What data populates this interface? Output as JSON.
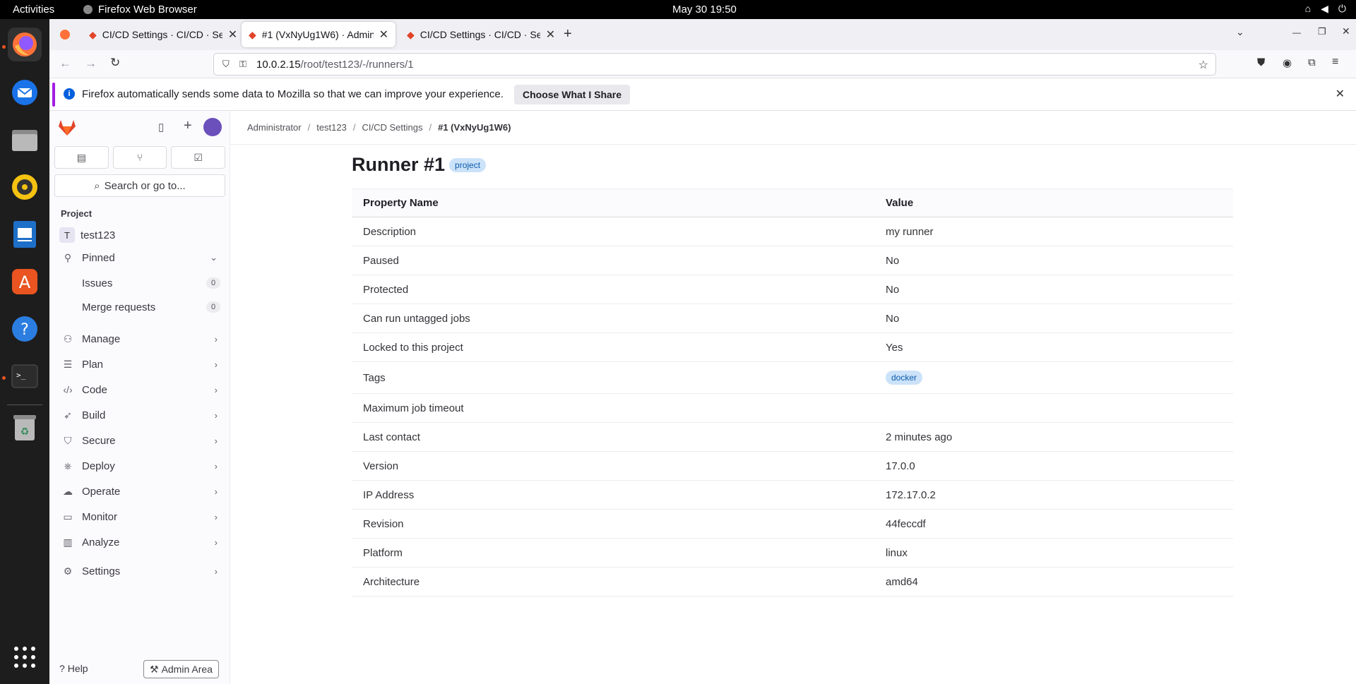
{
  "system": {
    "activities": "Activities",
    "app_name": "Firefox Web Browser",
    "clock": "May 30  19:50"
  },
  "browser": {
    "tabs": [
      {
        "title": "CI/CD Settings · CI/CD · Se"
      },
      {
        "title": "#1 (VxNyUg1W6) · Admin"
      },
      {
        "title": "CI/CD Settings · CI/CD · Se"
      }
    ],
    "url_host": "10.0.2.15",
    "url_path": "/root/test123/-/runners/1",
    "notification": {
      "message": "Firefox automatically sends some data to Mozilla so that we can improve your experience.",
      "button": "Choose What I Share"
    }
  },
  "sidebar": {
    "search_label": "Search or go to...",
    "section_label": "Project",
    "project_initial": "T",
    "project_name": "test123",
    "pinned_label": "Pinned",
    "pinned_items": [
      {
        "label": "Issues",
        "count": "0"
      },
      {
        "label": "Merge requests",
        "count": "0"
      }
    ],
    "nav_items": [
      {
        "label": "Manage",
        "icon": "users-icon"
      },
      {
        "label": "Plan",
        "icon": "planning-icon"
      },
      {
        "label": "Code",
        "icon": "code-icon"
      },
      {
        "label": "Build",
        "icon": "rocket-icon"
      },
      {
        "label": "Secure",
        "icon": "shield-icon"
      },
      {
        "label": "Deploy",
        "icon": "deployments-icon"
      },
      {
        "label": "Operate",
        "icon": "cloud-icon"
      },
      {
        "label": "Monitor",
        "icon": "monitor-icon"
      },
      {
        "label": "Analyze",
        "icon": "chart-icon"
      },
      {
        "label": "Settings",
        "icon": "gear-icon"
      }
    ],
    "help_label": "Help",
    "admin_label": "Admin Area"
  },
  "breadcrumb": [
    "Administrator",
    "test123",
    "CI/CD Settings",
    "#1 (VxNyUg1W6)"
  ],
  "page": {
    "title": "Runner #1",
    "badge": "project",
    "columns": [
      "Property Name",
      "Value"
    ],
    "rows": [
      {
        "name": "Description",
        "value": "my runner"
      },
      {
        "name": "Paused",
        "value": "No"
      },
      {
        "name": "Protected",
        "value": "No"
      },
      {
        "name": "Can run untagged jobs",
        "value": "No"
      },
      {
        "name": "Locked to this project",
        "value": "Yes"
      },
      {
        "name": "Tags",
        "value": "docker"
      },
      {
        "name": "Maximum job timeout",
        "value": ""
      },
      {
        "name": "Last contact",
        "value": "2 minutes ago"
      },
      {
        "name": "Version",
        "value": "17.0.0"
      },
      {
        "name": "IP Address",
        "value": "172.17.0.2"
      },
      {
        "name": "Revision",
        "value": "44feccdf"
      },
      {
        "name": "Platform",
        "value": "linux"
      },
      {
        "name": "Architecture",
        "value": "amd64"
      }
    ]
  }
}
